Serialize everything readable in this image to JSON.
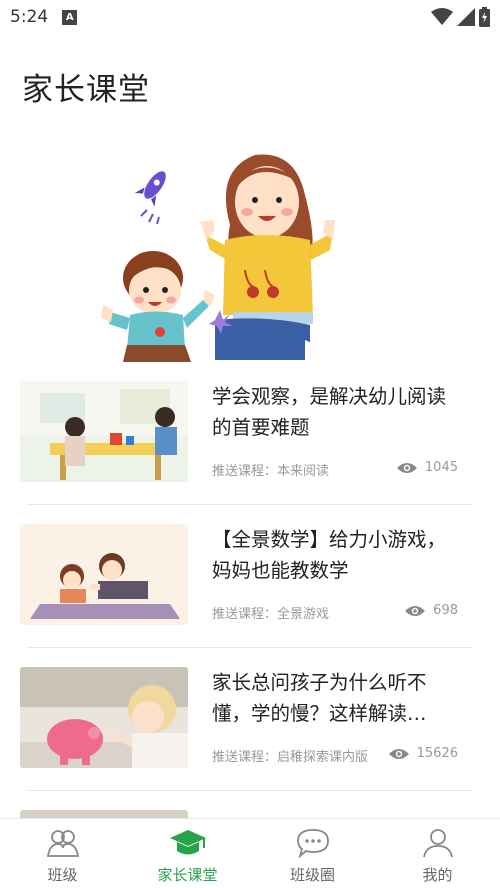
{
  "status": {
    "time": "5:24",
    "app_badge": "A"
  },
  "page_title": "家长课堂",
  "articles": [
    {
      "title": "学会观察，是解决幼儿阅读的首要难题",
      "meta": "推送课程：本来阅读",
      "views": "1045"
    },
    {
      "title": "【全景数学】给力小游戏，妈妈也能教数学",
      "meta": "推送课程：全景游戏",
      "views": "698"
    },
    {
      "title": "家长总问孩子为什么听不懂，学的慢？这样解读…",
      "meta": "推送课程：启稚探索课内版",
      "views": "15626"
    }
  ],
  "tabs": [
    {
      "label": "班级",
      "icon": "class-people-icon"
    },
    {
      "label": "家长课堂",
      "icon": "graduation-cap-icon",
      "active": true
    },
    {
      "label": "班级圈",
      "icon": "chat-bubble-icon"
    },
    {
      "label": "我的",
      "icon": "person-icon"
    }
  ],
  "colors": {
    "accent": "#2aa24a"
  }
}
